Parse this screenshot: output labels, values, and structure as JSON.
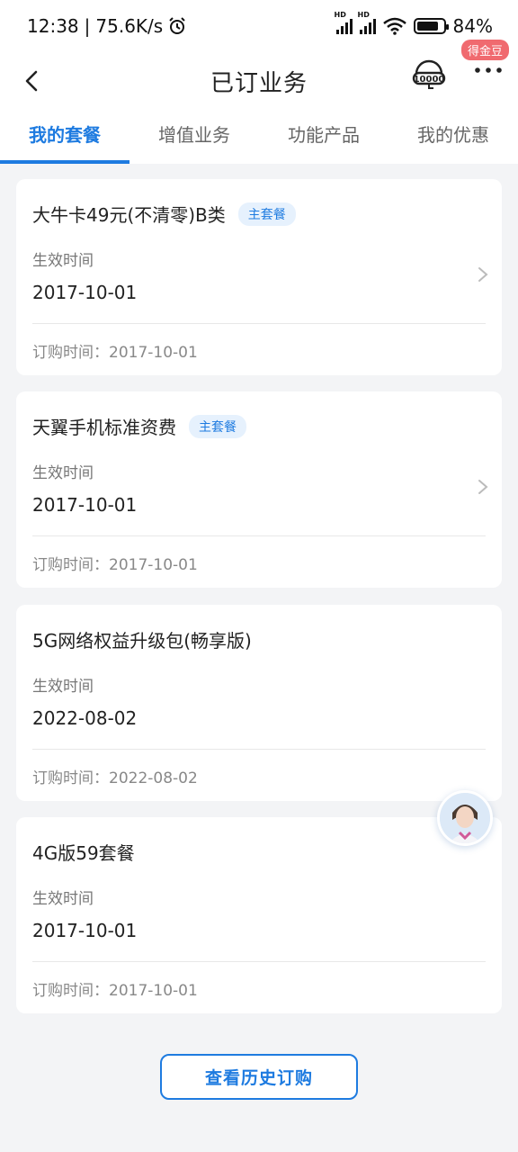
{
  "status_bar": {
    "time": "12:38",
    "speed": "75.6K/s",
    "alarm_icon": "alarm-icon",
    "signal_badge": "HD",
    "battery_percent": 84,
    "battery_text": "84%"
  },
  "header": {
    "title": "已订业务",
    "back_icon": "back-arrow-icon",
    "service_icon": "10000-customer-service-icon",
    "service_badge": "得金豆",
    "more_icon": "more-dots-icon"
  },
  "tabs": [
    {
      "label": "我的套餐",
      "active": true
    },
    {
      "label": "增值业务",
      "active": false
    },
    {
      "label": "功能产品",
      "active": false
    },
    {
      "label": "我的优惠",
      "active": false
    }
  ],
  "packages": [
    {
      "name": "大牛卡49元(不清零)B类",
      "tag": "主套餐",
      "effective_label": "生效时间",
      "effective_date": "2017-10-01",
      "order_text": "订购时间：2017-10-01",
      "has_arrow": true
    },
    {
      "name": "天翼手机标准资费",
      "tag": "主套餐",
      "effective_label": "生效时间",
      "effective_date": "2017-10-01",
      "order_text": "订购时间：2017-10-01",
      "has_arrow": true
    },
    {
      "name": "5G网络权益升级包(畅享版)",
      "tag": "",
      "effective_label": "生效时间",
      "effective_date": "2022-08-02",
      "order_text": "订购时间：2022-08-02",
      "has_arrow": false
    },
    {
      "name": "4G版59套餐",
      "tag": "",
      "effective_label": "生效时间",
      "effective_date": "2017-10-01",
      "order_text": "订购时间：2017-10-01",
      "has_arrow": false
    }
  ],
  "assistant": {
    "icon": "assistant-avatar-icon"
  },
  "history_button": "查看历史订购",
  "colors": {
    "accent": "#1e7be0",
    "badge": "#f06a6f",
    "background": "#f3f4f6"
  }
}
